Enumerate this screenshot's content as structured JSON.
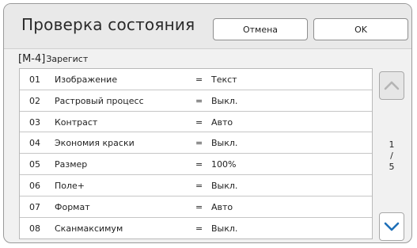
{
  "header": {
    "title": "Проверка состояния",
    "cancel_label": "Отмена",
    "ok_label": "OK"
  },
  "section": {
    "code": "[M-4]",
    "name": "Зарегист"
  },
  "rows": [
    {
      "num": "01",
      "label": "Изображение",
      "eq": "=",
      "value": "Текст"
    },
    {
      "num": "02",
      "label": "Растровый процесс",
      "eq": "=",
      "value": "Выкл."
    },
    {
      "num": "03",
      "label": "Контраст",
      "eq": "=",
      "value": "Авто"
    },
    {
      "num": "04",
      "label": "Экономия краски",
      "eq": "=",
      "value": "Выкл."
    },
    {
      "num": "05",
      "label": "Размер",
      "eq": "=",
      "value": "100%"
    },
    {
      "num": "06",
      "label": "Поле+",
      "eq": "=",
      "value": "Выкл."
    },
    {
      "num": "07",
      "label": "Формат",
      "eq": "=",
      "value": "Авто"
    },
    {
      "num": "08",
      "label": "Сканмаксимум",
      "eq": "=",
      "value": "Выкл."
    }
  ],
  "pager": {
    "current": "1",
    "separator": "/",
    "total": "5"
  },
  "icons": {
    "scroll_up": "chevron-up-icon",
    "scroll_down": "chevron-down-icon"
  },
  "colors": {
    "accent": "#1e6fb8",
    "disabled_icon": "#b4b4b4"
  }
}
